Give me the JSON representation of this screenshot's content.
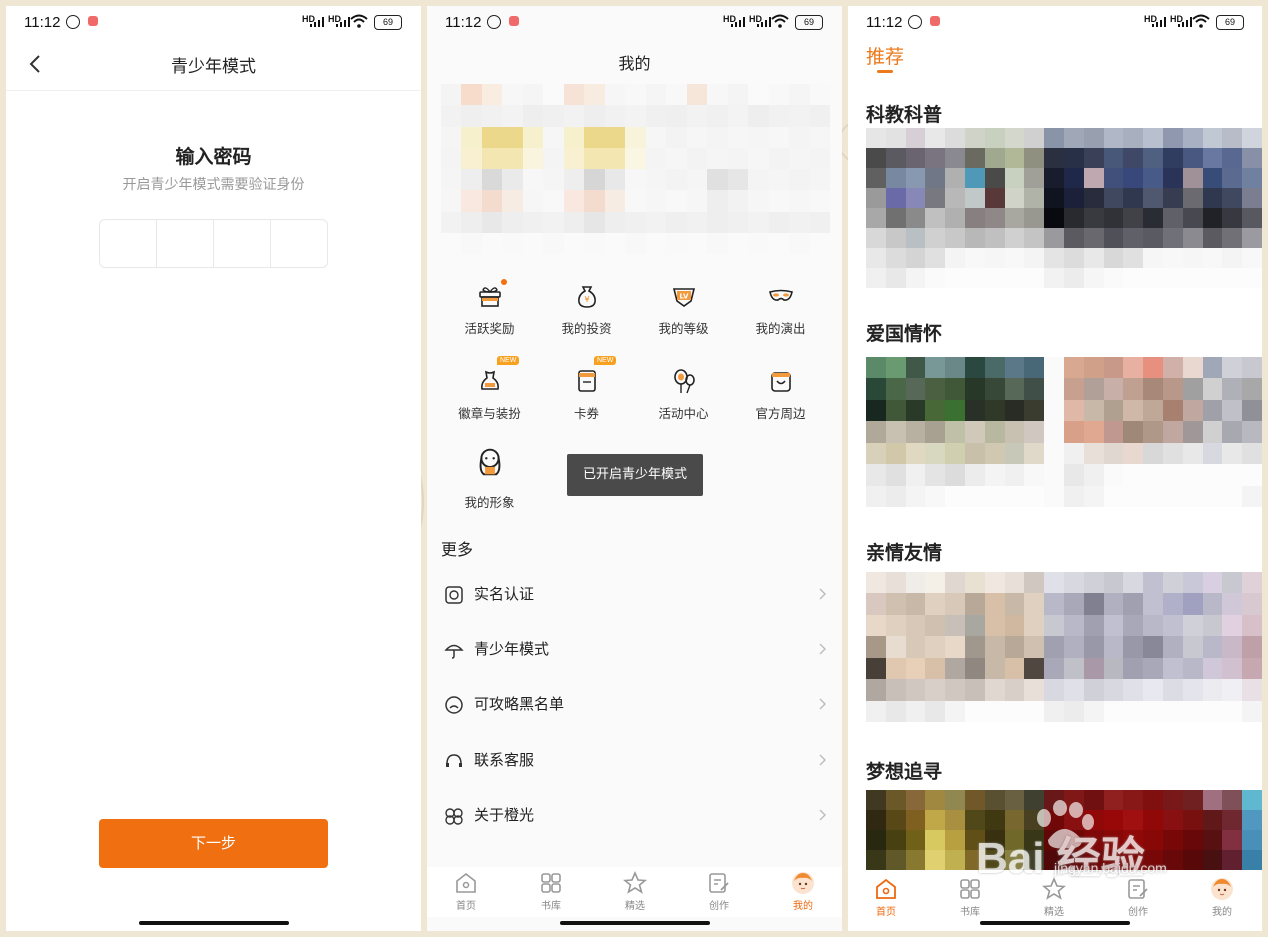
{
  "status_bar": {
    "time": "11:12",
    "battery": "69",
    "signal_label": "HD"
  },
  "teen_setup": {
    "title": "青少年模式",
    "heading": "输入密码",
    "subheading": "开启青少年模式需要验证身份",
    "next_button": "下一步"
  },
  "profile": {
    "title": "我的",
    "grid": [
      {
        "label": "活跃奖励",
        "icon": "gift-icon",
        "badge": "dot"
      },
      {
        "label": "我的投资",
        "icon": "money-bag-icon"
      },
      {
        "label": "我的等级",
        "icon": "level-badge-icon"
      },
      {
        "label": "我的演出",
        "icon": "mask-icon"
      },
      {
        "label": "徽章与装扮",
        "icon": "badge-costume-icon",
        "badge": "NEW"
      },
      {
        "label": "卡券",
        "icon": "coupon-icon",
        "badge": "NEW"
      },
      {
        "label": "活动中心",
        "icon": "balloon-icon"
      },
      {
        "label": "官方周边",
        "icon": "shopping-bag-icon"
      },
      {
        "label": "我的形象",
        "icon": "avatar-figure-icon"
      }
    ],
    "toast": "已开启青少年模式",
    "more_heading": "更多",
    "more_items": [
      {
        "label": "实名认证",
        "icon": "id-verify-icon"
      },
      {
        "label": "青少年模式",
        "icon": "umbrella-icon"
      },
      {
        "label": "可攻略黑名单",
        "icon": "sad-face-icon"
      },
      {
        "label": "联系客服",
        "icon": "headset-icon"
      },
      {
        "label": "关于橙光",
        "icon": "flower-icon"
      }
    ]
  },
  "tabbar": {
    "tabs": [
      {
        "label": "首页",
        "icon": "home-icon"
      },
      {
        "label": "书库",
        "icon": "grid-icon"
      },
      {
        "label": "精选",
        "icon": "star-icon"
      },
      {
        "label": "创作",
        "icon": "edit-icon"
      },
      {
        "label": "我的",
        "icon": "avatar-icon"
      }
    ],
    "profile_active": "我的",
    "recommend_active": "首页"
  },
  "recommend": {
    "tab": "推荐",
    "sections": [
      "科教科普",
      "爱国情怀",
      "亲情友情",
      "梦想追寻"
    ]
  },
  "watermark": {
    "logo": "Bai 经验",
    "url": "jingyan.baidu.com"
  },
  "colors": {
    "accent": "#f06f10",
    "toast_bg": "#4a4a4a"
  }
}
